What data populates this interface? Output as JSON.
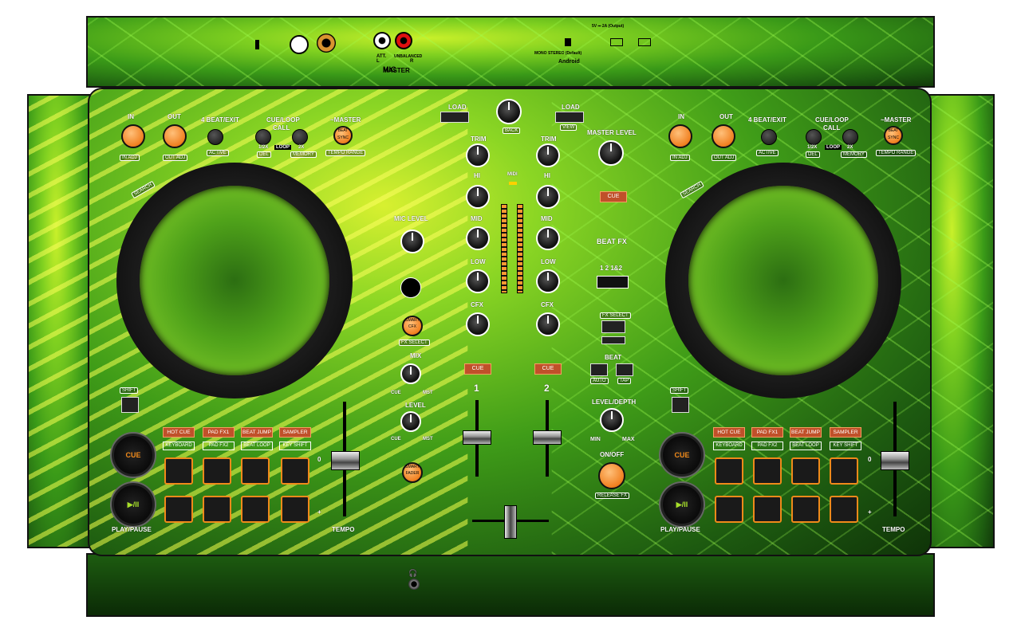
{
  "top_panel": {
    "mic": "MIC",
    "att": "ATT.",
    "unbalanced": "UNBALANCED",
    "master": "MASTER",
    "master_l": "L",
    "master_r": "R",
    "android": "Android",
    "mono_stereo": "MONO STEREO (Default)",
    "power_label": "5V ⎓ 2A (Output)",
    "colors": {
      "accent": "#f08a1a",
      "lime": "#a8e02a"
    }
  },
  "deck_left": {
    "in": "IN",
    "out": "OUT",
    "in_adj": "IN ADJ",
    "out_adj": "OUT ADJ",
    "four_beat": "4 BEAT/EXIT",
    "active": "ACTIVE",
    "cue_loop_call": "CUE/LOOP",
    "call": "CALL",
    "loop": "LOOP",
    "half_x": "1/2X",
    "two_x": "2X",
    "del": "DEL",
    "memory": "MEMORY",
    "master": "~MASTER",
    "beat_sync": "BEAT SYNC",
    "tempo_range": "TEMPO RANGE",
    "search": "SEARCH",
    "shift": "SHIFT",
    "modes": [
      "HOT CUE",
      "PAD FX1",
      "BEAT JUMP",
      "SAMPLER"
    ],
    "modes_shift": [
      "KEYBOARD",
      "PAD FX2",
      "BEAT LOOP",
      "KEY SHIFT"
    ],
    "cue": "CUE",
    "play_icon": "▶/II",
    "play_pause": "PLAY/PAUSE",
    "tempo": "TEMPO",
    "tempo_zero": "0",
    "tempo_plus": "+"
  },
  "deck_right": {
    "in": "IN",
    "out": "OUT",
    "in_adj": "IN ADJ",
    "out_adj": "OUT ADJ",
    "four_beat": "4 BEAT/EXIT",
    "active": "ACTIVE",
    "cue_loop_call": "CUE/LOOP",
    "call": "CALL",
    "loop": "LOOP",
    "half_x": "1/2X",
    "two_x": "2X",
    "del": "DEL",
    "memory": "MEMORY",
    "master": "~MASTER",
    "beat_sync": "BEAT SYNC",
    "tempo_range": "TEMPO RANGE",
    "search": "SEARCH",
    "shift": "SHIFT",
    "modes": [
      "HOT CUE",
      "PAD FX1",
      "BEAT JUMP",
      "SAMPLER"
    ],
    "modes_shift": [
      "KEYBOARD",
      "PAD FX2",
      "BEAT LOOP",
      "KEY SHIFT"
    ],
    "cue": "CUE",
    "play_icon": "▶/II",
    "play_pause": "PLAY/PAUSE",
    "tempo": "TEMPO",
    "tempo_zero": "0",
    "tempo_plus": "+"
  },
  "mixer": {
    "load": "LOAD",
    "back": "BACK",
    "view": "VIEW",
    "trim": "TRIM",
    "hi": "HI",
    "mid": "MID",
    "low": "LOW",
    "cfx": "CFX",
    "minus_inf": "-∞",
    "plus9": "+9",
    "minus26": "-26",
    "plus6": "+6",
    "low_lbl": "LOW",
    "hi_lbl": "HI",
    "midi": "MIDI",
    "mic_level": "MIC LEVEL",
    "zero": "0",
    "smart_cfx": "SMART CFX",
    "fx_select": "FX SELECT",
    "mix": "MIX",
    "level": "LEVEL",
    "cue_lbl": "CUE",
    "mst": "MST",
    "smart_fader": "SMART FADER",
    "cue": "CUE",
    "ch1": "1",
    "ch2": "2",
    "master_level": "MASTER LEVEL",
    "master_cue": "CUE",
    "beat_fx": "BEAT FX",
    "beat_fx_select": "1  2  1&2",
    "fx_select_btn": "FX SELECT",
    "beat": "BEAT",
    "auto": "AUTO",
    "tap": "TAP",
    "level_depth": "LEVEL/DEPTH",
    "min": "MIN",
    "max": "MAX",
    "on_off": "ON/OFF",
    "release_fx": "RELEASE FX"
  }
}
